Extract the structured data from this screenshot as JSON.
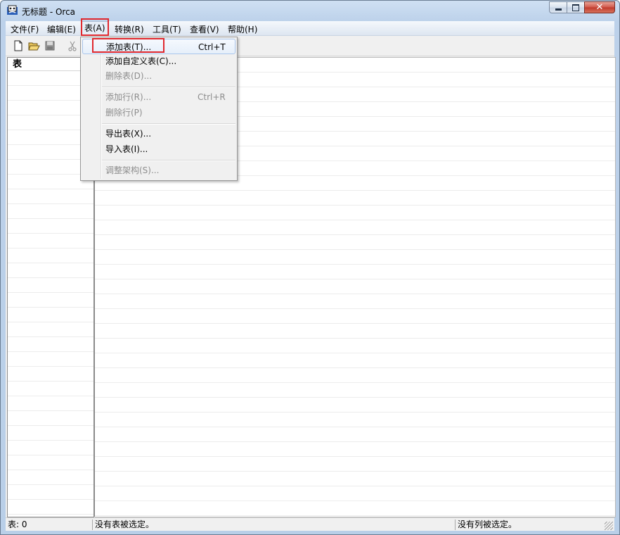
{
  "window": {
    "title": "无标题 - Orca",
    "app_icon": "orca-app-icon"
  },
  "menubar": {
    "items": [
      {
        "label": "文件(F)"
      },
      {
        "label": "编辑(E)"
      },
      {
        "label": "表(A)"
      },
      {
        "label": "转换(R)"
      },
      {
        "label": "工具(T)"
      },
      {
        "label": "查看(V)"
      },
      {
        "label": "帮助(H)"
      }
    ]
  },
  "toolbar": {
    "icons": [
      "new-file-icon",
      "open-folder-icon",
      "save-icon",
      "cut-icon"
    ]
  },
  "left_pane": {
    "header": "表"
  },
  "table_menu": {
    "items": [
      {
        "label": "添加表(T)...",
        "shortcut": "Ctrl+T",
        "enabled": true
      },
      {
        "label": "添加自定义表(C)...",
        "shortcut": "",
        "enabled": true
      },
      {
        "label": "删除表(D)...",
        "shortcut": "",
        "enabled": false
      },
      {
        "label": "添加行(R)...",
        "shortcut": "Ctrl+R",
        "enabled": false
      },
      {
        "label": "删除行(P)",
        "shortcut": "",
        "enabled": false
      },
      {
        "label": "导出表(X)...",
        "shortcut": "",
        "enabled": true
      },
      {
        "label": "导入表(I)...",
        "shortcut": "",
        "enabled": true
      },
      {
        "label": "调整架构(S)...",
        "shortcut": "",
        "enabled": false
      }
    ]
  },
  "statusbar": {
    "table_count": "表: 0",
    "table_status": "没有表被选定。",
    "column_status": "没有列被选定。"
  },
  "colors": {
    "highlight_box": "#e0282e",
    "menu_hover": "#aac6ec"
  }
}
